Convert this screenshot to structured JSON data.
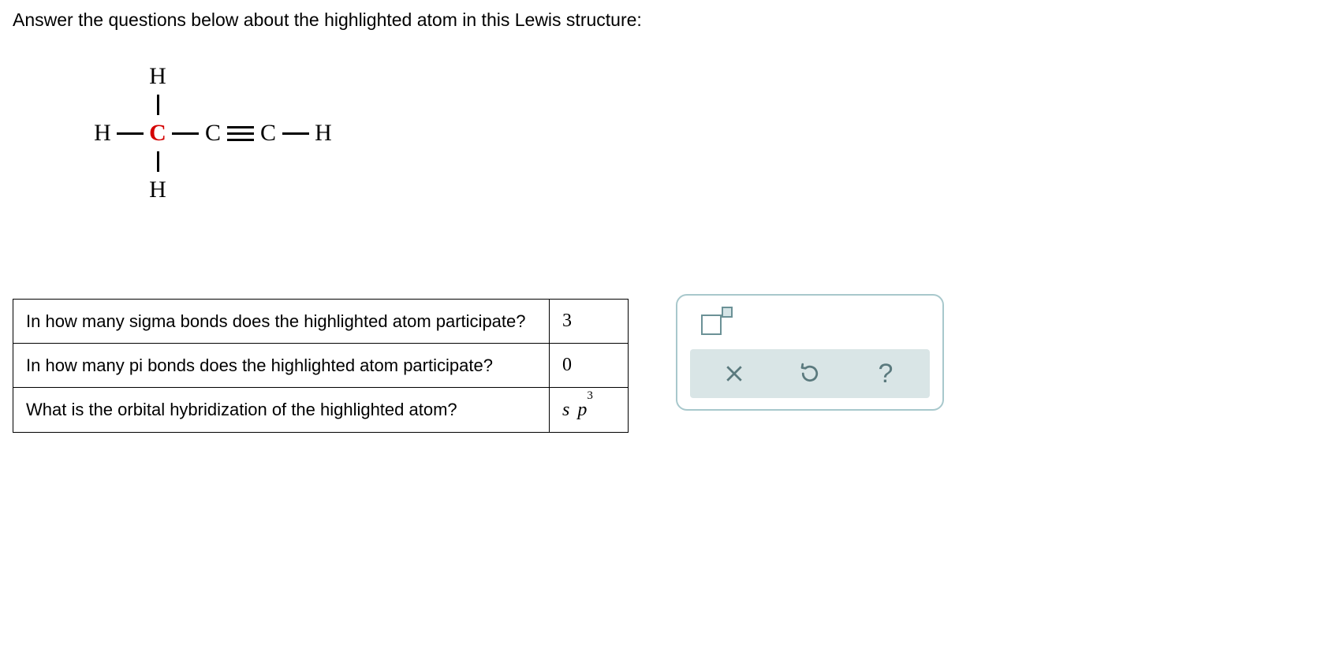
{
  "prompt": "Answer the questions below about the highlighted atom in this Lewis structure:",
  "lewis": {
    "atoms": {
      "h": "H",
      "c": "C"
    }
  },
  "table": {
    "rows": [
      {
        "question": "In how many sigma bonds does the highlighted atom participate?",
        "answer": "3"
      },
      {
        "question": "In how many pi bonds does the highlighted atom participate?",
        "answer": "0"
      },
      {
        "question": "What is the orbital hybridization of the highlighted atom?",
        "answer_base": "s p",
        "answer_sup": "3"
      }
    ]
  },
  "tools": {
    "superscript": "superscript-tool",
    "clear": "clear",
    "reset": "reset",
    "help": "?"
  }
}
